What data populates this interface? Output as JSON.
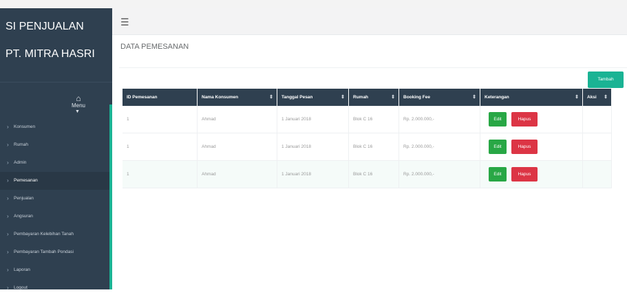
{
  "sidebar": {
    "brand_line1": "SI PENJUALAN",
    "brand_line2": "PT. MITRA HASRI",
    "menu_label": "Menu",
    "items": [
      {
        "label": "Konsumen",
        "active": false
      },
      {
        "label": "Rumah",
        "active": false
      },
      {
        "label": "Admin",
        "active": false
      },
      {
        "label": "Pemesanan",
        "active": true
      },
      {
        "label": "Penjualan",
        "active": false
      },
      {
        "label": "Angsuran",
        "active": false
      },
      {
        "label": "Pembayaran Kelebihan Tanah",
        "active": false
      },
      {
        "label": "Pembayaran Tambah Pondasi",
        "active": false
      },
      {
        "label": "Laporan",
        "active": false
      },
      {
        "label": "Logout",
        "active": false
      }
    ]
  },
  "header": {
    "menu_icon": "hamburger-icon"
  },
  "page": {
    "title": "DATA PEMESANAN",
    "add_button": "Tambah"
  },
  "table": {
    "columns": [
      "ID Pemesanan",
      "Nama Konsumen",
      "Tanggal Pesan",
      "Rumah",
      "Booking Fee",
      "Keterangan",
      "Aksi"
    ],
    "rows": [
      {
        "id": "1",
        "nama": "Ahmad",
        "tanggal": "1 Januari 2018",
        "rumah": "Blok C 16",
        "booking": "Rp. 2.000.000,-",
        "edit": "Edit",
        "hapus": "Hapus"
      },
      {
        "id": "1",
        "nama": "Ahmad",
        "tanggal": "1 Januari 2018",
        "rumah": "Blok C 16",
        "booking": "Rp. 2.000.000,-",
        "edit": "Edit",
        "hapus": "Hapus"
      },
      {
        "id": "1",
        "nama": "Ahmad",
        "tanggal": "1 Januari 2018",
        "rumah": "Blok C 16",
        "booking": "Rp. 2.000.000,-",
        "edit": "Edit",
        "hapus": "Hapus"
      }
    ]
  },
  "colors": {
    "sidebar_bg": "#2f4050",
    "accent": "#1ab394",
    "edit": "#28a745",
    "delete": "#dc3545"
  }
}
